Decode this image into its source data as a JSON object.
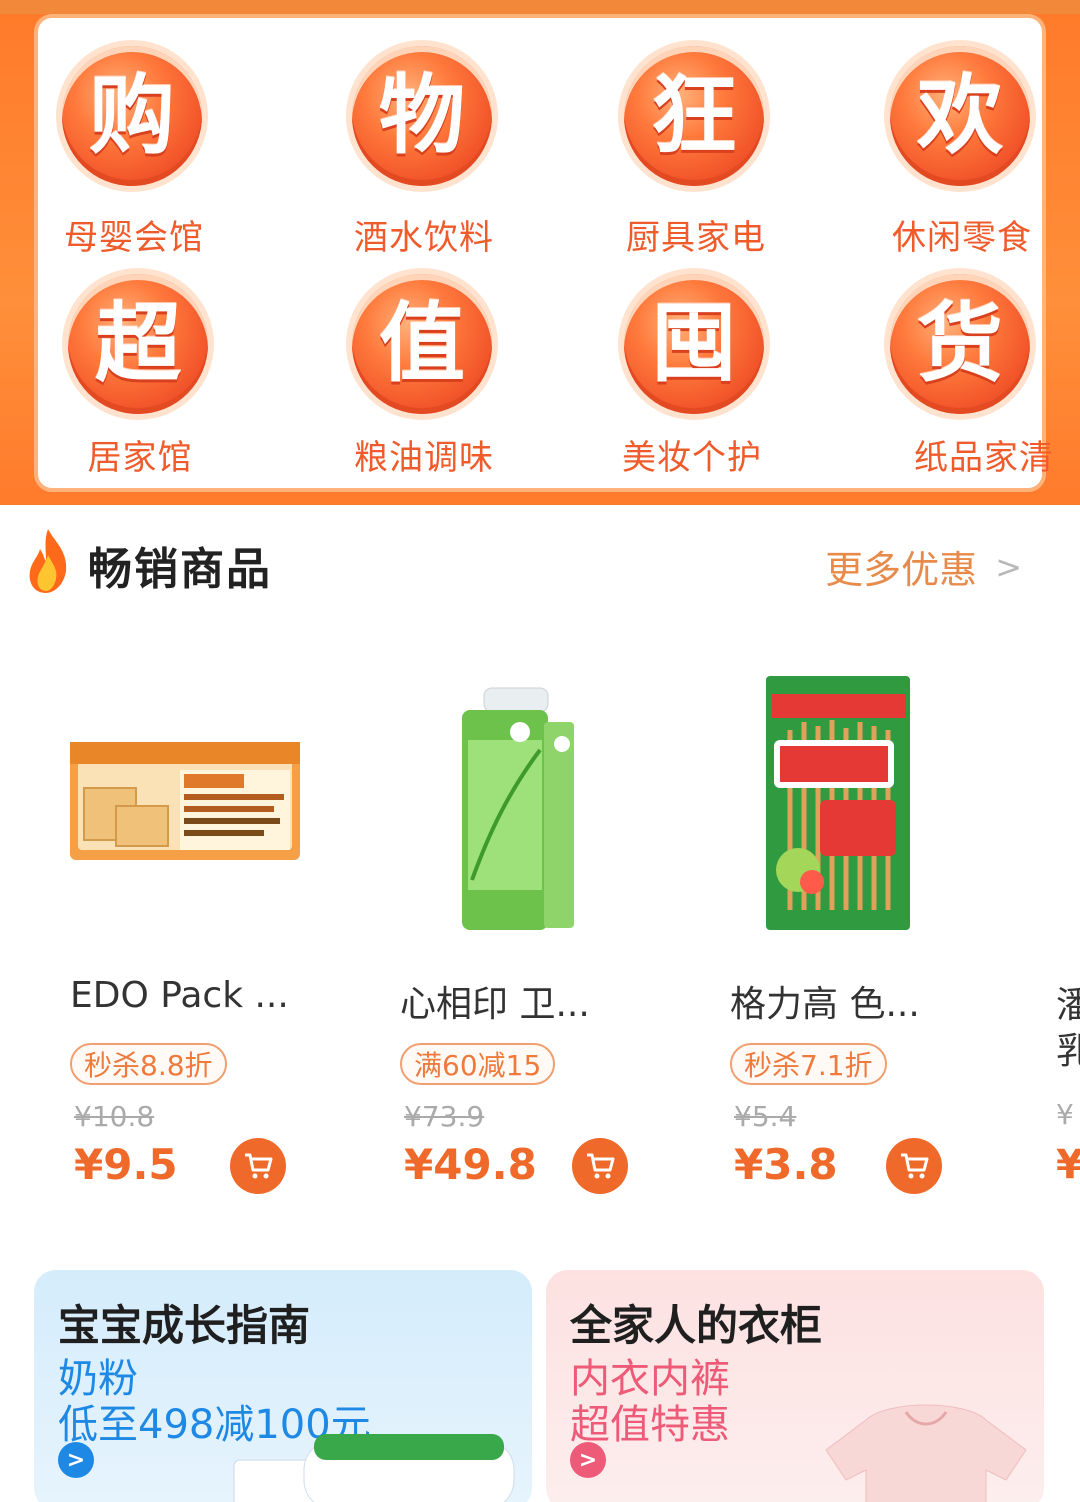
{
  "categories": [
    {
      "glyph": "购",
      "label": "母婴会馆"
    },
    {
      "glyph": "物",
      "label": "酒水饮料"
    },
    {
      "glyph": "狂",
      "label": "厨具家电"
    },
    {
      "glyph": "欢",
      "label": "休闲零食"
    },
    {
      "glyph": "超",
      "label": "居家馆"
    },
    {
      "glyph": "值",
      "label": "粮油调味"
    },
    {
      "glyph": "囤",
      "label": "美妆个护"
    },
    {
      "glyph": "货",
      "label": "纸品家清"
    }
  ],
  "section": {
    "title": "畅销商品",
    "more_label": "更多优惠",
    "more_arrow": ">"
  },
  "products": [
    {
      "name": "EDO Pack ...",
      "promo": "秒杀8.8折",
      "old_price": "¥10.8",
      "price": "¥9.5"
    },
    {
      "name": "心相印 卫...",
      "promo": "满60减15",
      "old_price": "¥73.9",
      "price": "¥49.8"
    },
    {
      "name": "格力高 色...",
      "promo": "秒杀7.1折",
      "old_price": "¥5.4",
      "price": "¥3.8"
    }
  ],
  "peek": {
    "line1": "潘",
    "line2": "乳",
    "old": "¥",
    "price": "¥"
  },
  "banners": [
    {
      "title": "宝宝成长指南",
      "sub1": "奶粉",
      "sub2": "低至498减100元",
      "go": ">"
    },
    {
      "title": "全家人的衣柜",
      "sub1": "内衣内裤",
      "sub2": "超值特惠",
      "go": ">"
    }
  ],
  "colors": {
    "accent": "#ef6a2a",
    "brand_orange": "#ff7a2a",
    "blue": "#1e88e5",
    "pink": "#ee5b78"
  }
}
